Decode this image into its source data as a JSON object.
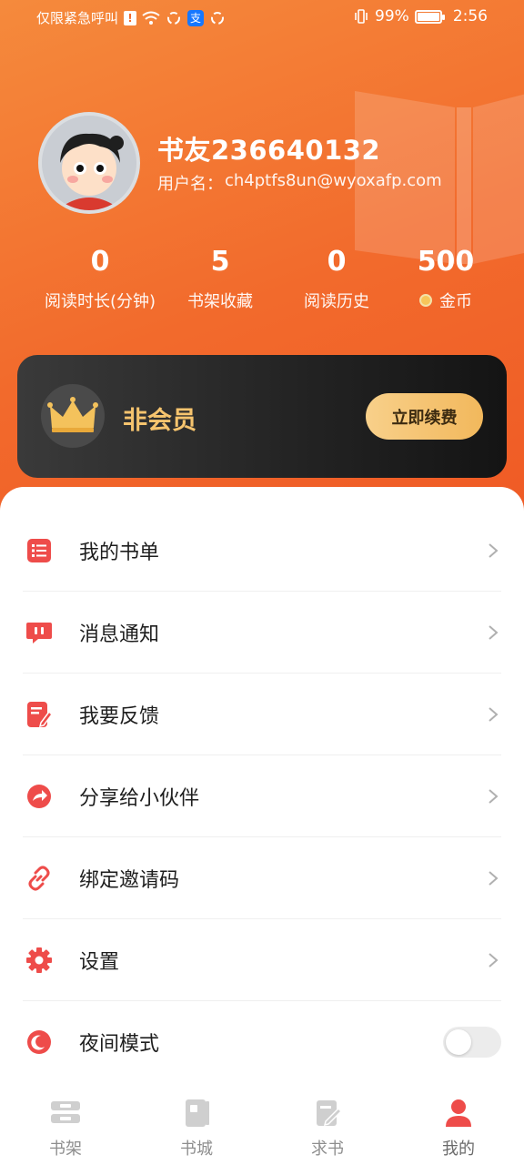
{
  "status_bar": {
    "left_text": "仅限紧急呼叫",
    "battery": "99%",
    "time": "2:56"
  },
  "profile": {
    "name": "书友236640132",
    "account_prefix": "用户名：",
    "account": "ch4ptfs8un@wyoxafp.com"
  },
  "stats": [
    {
      "value": "0",
      "label": "阅读时长(分钟)"
    },
    {
      "value": "5",
      "label": "书架收藏"
    },
    {
      "value": "0",
      "label": "阅读历史"
    },
    {
      "value": "500",
      "label": "金币"
    }
  ],
  "vip": {
    "status": "非会员",
    "button": "立即续费"
  },
  "menu": [
    {
      "label": "我的书单",
      "icon": "list-icon"
    },
    {
      "label": "消息通知",
      "icon": "message-icon"
    },
    {
      "label": "我要反馈",
      "icon": "feedback-icon"
    },
    {
      "label": "分享给小伙伴",
      "icon": "share-icon"
    },
    {
      "label": "绑定邀请码",
      "icon": "link-icon"
    },
    {
      "label": "设置",
      "icon": "gear-icon"
    },
    {
      "label": "夜间模式",
      "icon": "moon-icon",
      "toggle": false
    }
  ],
  "bottom_nav": [
    {
      "label": "书架",
      "icon": "bookshelf-icon"
    },
    {
      "label": "书城",
      "icon": "bookstore-icon"
    },
    {
      "label": "求书",
      "icon": "request-book-icon"
    },
    {
      "label": "我的",
      "icon": "profile-icon",
      "active": true
    }
  ],
  "colors": {
    "accent": "#f26a2c",
    "menu_icon": "#ee4c4a",
    "vip_gold": "#f6c46e"
  }
}
